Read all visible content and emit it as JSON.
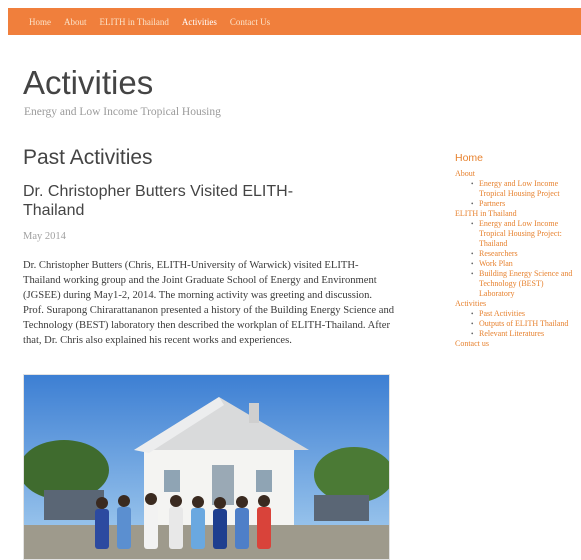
{
  "nav": {
    "items": [
      {
        "label": "Home"
      },
      {
        "label": "About"
      },
      {
        "label": "ELITH in Thailand"
      },
      {
        "label": "Activities"
      },
      {
        "label": "Contact Us"
      }
    ]
  },
  "header": {
    "title": "Activities",
    "tagline": "Energy and Low Income Tropical Housing"
  },
  "main": {
    "heading": "Past Activities",
    "post": {
      "title": "Dr. Christopher Butters Visited ELITH-Thailand",
      "date": "May 2014",
      "body": "Dr. Christopher Butters (Chris, ELITH-University of Warwick) visited ELITH-Thailand working group and the Joint Graduate School of Energy and Environment (JGSEE) during May1-2, 2014. The morning activity was greeting and discussion. Prof. Surapong Chirarattananon presented a history of the Building Energy Science and Technology (BEST) laboratory then described the workplan of ELITH-Thailand. After that, Dr. Chris also explained his recent works and experiences."
    }
  },
  "sidebar": {
    "home": "Home",
    "items": [
      {
        "label": "About"
      },
      {
        "label": "Energy and Low Income Tropical Housing Project"
      },
      {
        "label": "Partners"
      },
      {
        "label": "ELITH in Thailand"
      },
      {
        "label": "Energy and Low Income Tropical Housing Project: Thailand"
      },
      {
        "label": "Researchers"
      },
      {
        "label": "Work Plan"
      },
      {
        "label": "Building Energy Science and Technology (BEST) Laboratory"
      },
      {
        "label": "Activities"
      },
      {
        "label": "Past Activities"
      },
      {
        "label": "Outputs of ELITH Thailand"
      },
      {
        "label": "Relevant Literatures"
      },
      {
        "label": "Contact us"
      }
    ]
  },
  "colors": {
    "accent": "#f07f3c",
    "link": "#e7822f",
    "text": "#444444"
  }
}
